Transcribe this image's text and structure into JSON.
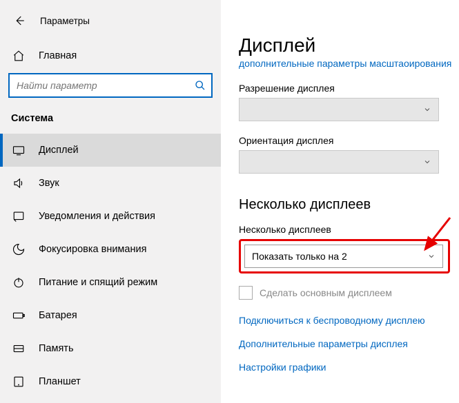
{
  "window_title": "Параметры",
  "home_label": "Главная",
  "search_placeholder": "Найти параметр",
  "section_header": "Система",
  "nav": [
    {
      "key": "display",
      "label": "Дисплей",
      "active": true
    },
    {
      "key": "sound",
      "label": "Звук"
    },
    {
      "key": "notif",
      "label": "Уведомления и действия"
    },
    {
      "key": "focus",
      "label": "Фокусировка внимания"
    },
    {
      "key": "power",
      "label": "Питание и спящий режим"
    },
    {
      "key": "battery",
      "label": "Батарея"
    },
    {
      "key": "storage",
      "label": "Память"
    },
    {
      "key": "tablet",
      "label": "Планшет"
    }
  ],
  "page": {
    "title": "Дисплей",
    "advanced_scaling_link": "дополнительные параметры масштаоирования",
    "resolution_label": "Разрешение дисплея",
    "orientation_label": "Ориентация дисплея",
    "multi_heading": "Несколько дисплеев",
    "multi_label": "Несколько дисплеев",
    "multi_value": "Показать только на 2",
    "make_primary_label": "Сделать основным дисплеем",
    "links": {
      "wireless": "Подключиться к беспроводному дисплею",
      "adv_display": "Дополнительные параметры дисплея",
      "graphics": "Настройки графики"
    }
  },
  "annotation": {
    "highlight_color": "#e60000"
  }
}
